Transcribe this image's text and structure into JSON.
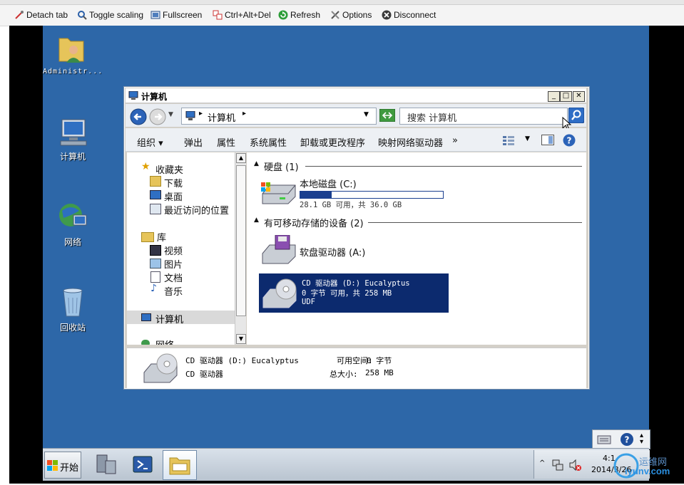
{
  "viewer_toolbar": {
    "items": [
      {
        "label": "Detach tab",
        "icon": "detach-icon"
      },
      {
        "label": "Toggle scaling",
        "icon": "magnifier-icon"
      },
      {
        "label": "Fullscreen",
        "icon": "fullscreen-icon"
      },
      {
        "label": "Ctrl+Alt+Del",
        "icon": "keyboard-icon"
      },
      {
        "label": "Refresh",
        "icon": "refresh-icon"
      },
      {
        "label": "Options",
        "icon": "tools-icon"
      },
      {
        "label": "Disconnect",
        "icon": "disconnect-icon"
      }
    ]
  },
  "desktop": {
    "icons": [
      {
        "label": "Administr...",
        "icon": "user-folder-icon"
      },
      {
        "label": "计算机",
        "icon": "computer-icon"
      },
      {
        "label": "网络",
        "icon": "network-icon"
      },
      {
        "label": "回收站",
        "icon": "recycle-bin-icon"
      }
    ]
  },
  "explorer": {
    "title": "计算机",
    "address": {
      "crumb": "计算机",
      "search_placeholder": "搜索 计算机"
    },
    "commands": [
      "组织",
      "弹出",
      "属性",
      "系统属性",
      "卸载或更改程序",
      "映射网络驱动器",
      "»"
    ],
    "nav": {
      "favorites": "收藏夹",
      "favorites_items": [
        "下载",
        "桌面",
        "最近访问的位置"
      ],
      "libraries": "库",
      "library_items": [
        "视频",
        "图片",
        "文档",
        "音乐"
      ],
      "computer": "计算机",
      "network": "网络"
    },
    "groups": {
      "hard_disks": {
        "label": "硬盘",
        "count": "(1)"
      },
      "removable": {
        "label": "有可移动存储的设备",
        "count": "(2)"
      }
    },
    "drives": {
      "c": {
        "name": "本地磁盘 (C:)",
        "free_text": "28.1 GB 可用，共 36.0 GB",
        "used_fraction": 0.22
      },
      "a": {
        "name": "软盘驱动器 (A:)"
      },
      "d": {
        "name": "CD 驱动器 (D:) Eucalyptus",
        "line2": "0 字节 可用，共 258 MB",
        "line3": "UDF"
      }
    },
    "details": {
      "title": "CD 驱动器 (D:) Eucalyptus",
      "free_label": "可用空间:",
      "free_value": "0 字节",
      "type": "CD 驱动器",
      "size_label": "总大小:",
      "size_value": "258 MB"
    }
  },
  "taskbar": {
    "start_label": "开始",
    "clock_time": "4:1",
    "clock_date": "2014/3/26"
  },
  "watermark": {
    "line1": "运维网",
    "line2": "iyunv.com"
  },
  "colors": {
    "desktop": "#2d67a8",
    "selection": "#0c2a6e",
    "accent": "#1a3f8f"
  }
}
